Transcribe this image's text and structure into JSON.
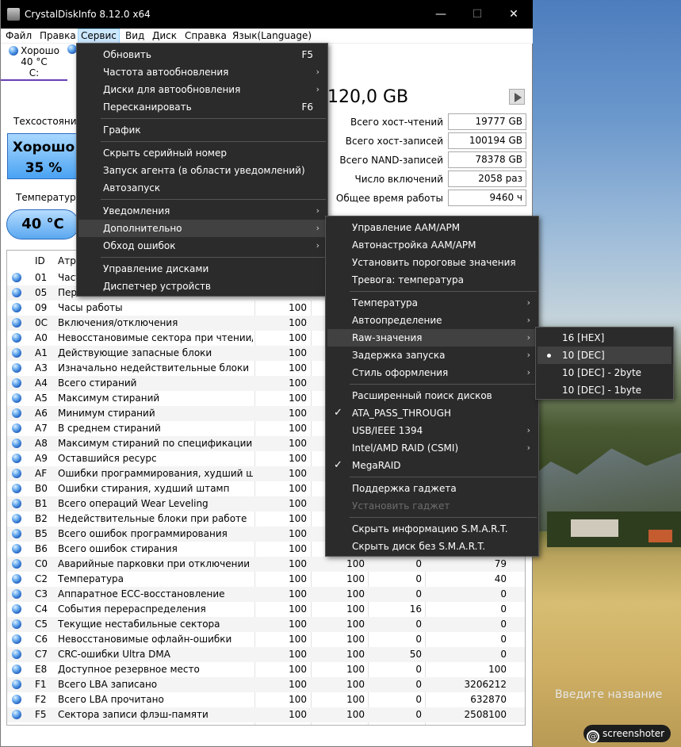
{
  "window": {
    "title": "CrystalDiskInfo 8.12.0 x64",
    "minimize": "—",
    "maximize": "☐",
    "close": "✕"
  },
  "menubar": [
    "Файл",
    "Правка",
    "Сервис",
    "Вид",
    "Диск",
    "Справка",
    "Язык(Language)"
  ],
  "disk_tab": {
    "status": "Хорошо",
    "temp": "40 °C",
    "letter": "C:"
  },
  "health": {
    "label": "Техсостояние",
    "status": "Хорошо",
    "percent": "35 %"
  },
  "temperature": {
    "label": "Температура",
    "value": "40 °C"
  },
  "capacity": "120,0 GB",
  "stats": [
    {
      "label": "Всего хост-чтений",
      "value": "19777 GB"
    },
    {
      "label": "Всего хост-записей",
      "value": "100194 GB"
    },
    {
      "label": "Всего NAND-записей",
      "value": "78378 GB"
    },
    {
      "label": "Число включений",
      "value": "2058 раз"
    },
    {
      "label": "Общее время работы",
      "value": "9460 ч"
    }
  ],
  "smart_header": {
    "id": "ID",
    "attr": "Атри"
  },
  "smart_rows": [
    {
      "id": "01",
      "name": "Част",
      "cur": "",
      "wor": "",
      "thr": "",
      "raw": ""
    },
    {
      "id": "05",
      "name": "Пере",
      "cur": "",
      "wor": "",
      "thr": "",
      "raw": ""
    },
    {
      "id": "09",
      "name": "Часы работы",
      "cur": "100",
      "wor": "",
      "thr": "",
      "raw": ""
    },
    {
      "id": "0C",
      "name": "Включения/отключения",
      "cur": "100",
      "wor": "",
      "thr": "",
      "raw": ""
    },
    {
      "id": "A0",
      "name": "Невосстановимые сектора при чтении/за...",
      "cur": "100",
      "wor": "",
      "thr": "",
      "raw": ""
    },
    {
      "id": "A1",
      "name": "Действующие запасные блоки",
      "cur": "100",
      "wor": "",
      "thr": "",
      "raw": ""
    },
    {
      "id": "A3",
      "name": "Изначально недействительные блоки",
      "cur": "100",
      "wor": "",
      "thr": "",
      "raw": ""
    },
    {
      "id": "A4",
      "name": "Всего стираний",
      "cur": "100",
      "wor": "",
      "thr": "",
      "raw": ""
    },
    {
      "id": "A5",
      "name": "Максимум стираний",
      "cur": "100",
      "wor": "",
      "thr": "",
      "raw": ""
    },
    {
      "id": "A6",
      "name": "Минимум стираний",
      "cur": "100",
      "wor": "",
      "thr": "",
      "raw": ""
    },
    {
      "id": "A7",
      "name": "В среднем стираний",
      "cur": "100",
      "wor": "",
      "thr": "",
      "raw": ""
    },
    {
      "id": "A8",
      "name": "Максимум стираний по спецификации",
      "cur": "100",
      "wor": "",
      "thr": "",
      "raw": ""
    },
    {
      "id": "A9",
      "name": "Оставшийся ресурс",
      "cur": "100",
      "wor": "",
      "thr": "",
      "raw": ""
    },
    {
      "id": "AF",
      "name": "Ошибки программирования, худший шта...",
      "cur": "100",
      "wor": "",
      "thr": "",
      "raw": ""
    },
    {
      "id": "B0",
      "name": "Ошибки стирания, худший штамп",
      "cur": "100",
      "wor": "",
      "thr": "",
      "raw": ""
    },
    {
      "id": "B1",
      "name": "Всего операций Wear Leveling",
      "cur": "100",
      "wor": "",
      "thr": "",
      "raw": ""
    },
    {
      "id": "B2",
      "name": "Недействительные блоки при работе",
      "cur": "100",
      "wor": "",
      "thr": "",
      "raw": ""
    },
    {
      "id": "B5",
      "name": "Всего ошибок программирования",
      "cur": "100",
      "wor": "",
      "thr": "",
      "raw": ""
    },
    {
      "id": "B6",
      "name": "Всего ошибок стирания",
      "cur": "100",
      "wor": "",
      "thr": "",
      "raw": ""
    },
    {
      "id": "C0",
      "name": "Аварийные парковки при отключении пи...",
      "cur": "100",
      "wor": "100",
      "thr": "0",
      "raw": "79"
    },
    {
      "id": "C2",
      "name": "Температура",
      "cur": "100",
      "wor": "100",
      "thr": "0",
      "raw": "40"
    },
    {
      "id": "C3",
      "name": "Аппаратное ECC-восстановление",
      "cur": "100",
      "wor": "100",
      "thr": "0",
      "raw": "0"
    },
    {
      "id": "C4",
      "name": "События перераспределения",
      "cur": "100",
      "wor": "100",
      "thr": "16",
      "raw": "0"
    },
    {
      "id": "C5",
      "name": "Текущие нестабильные сектора",
      "cur": "100",
      "wor": "100",
      "thr": "0",
      "raw": "0"
    },
    {
      "id": "C6",
      "name": "Невосстановимые офлайн-ошибки",
      "cur": "100",
      "wor": "100",
      "thr": "0",
      "raw": "0"
    },
    {
      "id": "C7",
      "name": "CRC-ошибки Ultra DMA",
      "cur": "100",
      "wor": "100",
      "thr": "50",
      "raw": "0"
    },
    {
      "id": "E8",
      "name": "Доступное резервное место",
      "cur": "100",
      "wor": "100",
      "thr": "0",
      "raw": "100"
    },
    {
      "id": "F1",
      "name": "Всего LBA записано",
      "cur": "100",
      "wor": "100",
      "thr": "0",
      "raw": "3206212"
    },
    {
      "id": "F2",
      "name": "Всего LBA прочитано",
      "cur": "100",
      "wor": "100",
      "thr": "0",
      "raw": "632870"
    },
    {
      "id": "F5",
      "name": "Сектора записи флэш-памяти",
      "cur": "100",
      "wor": "100",
      "thr": "0",
      "raw": "2508100"
    }
  ],
  "service_menu": {
    "refresh": "Обновить",
    "refresh_key": "F5",
    "autorefresh_freq": "Частота автообновления",
    "autorefresh_disks": "Диски для автообновления",
    "rescan": "Пересканировать",
    "rescan_key": "F6",
    "graph": "График",
    "hide_serial": "Скрыть серийный номер",
    "agent": "Запуск агента (в области уведомлений)",
    "autostart": "Автозапуск",
    "notifications": "Уведомления",
    "advanced": "Дополнительно",
    "error_bypass": "Обход ошибок",
    "disk_management": "Управление дисками",
    "device_manager": "Диспетчер устройств"
  },
  "advanced_menu": {
    "aam_apm": "Управление AAM/APM",
    "aam_auto": "Автонастройка AAM/APM",
    "thresholds": "Установить пороговые значения",
    "alarm_temp": "Тревога: температура",
    "temperature": "Температура",
    "autodetect": "Автоопределение",
    "raw_values": "Raw-значения",
    "startup_delay": "Задержка запуска",
    "style": "Стиль оформления",
    "ext_search": "Расширенный поиск дисков",
    "ata_pass": "ATA_PASS_THROUGH",
    "usb": "USB/IEEE 1394",
    "intel_raid": "Intel/AMD RAID (CSMI)",
    "megaraid": "MegaRAID",
    "gadget_support": "Поддержка гаджета",
    "install_gadget": "Установить гаджет",
    "hide_smart": "Скрыть информацию S.M.A.R.T.",
    "hide_no_smart": "Скрыть диск без S.M.A.R.T."
  },
  "raw_menu": [
    "16 [HEX]",
    "10 [DEC]",
    "10 [DEC] - 2byte",
    "10 [DEC] - 1byte"
  ],
  "desktop": {
    "activate_text": "Введите название",
    "screenshot_badge": "screenshoter"
  },
  "colors": {
    "menu_bg": "#2b2b2b",
    "menu_highlight": "#414141",
    "health_blue": "#4aa3f3",
    "tab_underline": "#6a3fb5"
  }
}
